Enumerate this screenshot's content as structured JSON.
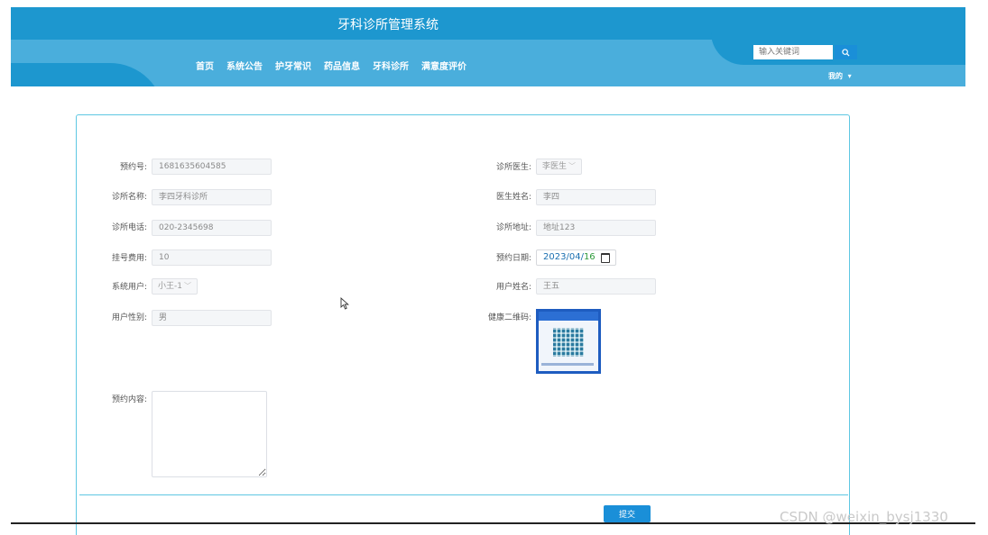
{
  "header": {
    "site_title": "牙科诊所管理系统",
    "nav": [
      "首页",
      "系统公告",
      "护牙常识",
      "药品信息",
      "牙科诊所",
      "满意度评价"
    ],
    "search_placeholder": "输入关键词",
    "user_menu": "我的"
  },
  "form": {
    "booking_no": {
      "label": "预约号:",
      "value": "1681635604585"
    },
    "clinic_name": {
      "label": "诊所名称:",
      "value": "李四牙科诊所"
    },
    "clinic_phone": {
      "label": "诊所电话:",
      "value": "020-2345698"
    },
    "reg_fee": {
      "label": "挂号费用:",
      "value": "10"
    },
    "sys_user": {
      "label": "系统用户:",
      "value": "小王-1"
    },
    "user_gender": {
      "label": "用户性别:",
      "value": "男"
    },
    "booking_content": {
      "label": "预约内容:",
      "value": ""
    },
    "clinic_doctor": {
      "label": "诊所医生:",
      "value": "李医生"
    },
    "doctor_name": {
      "label": "医生姓名:",
      "value": "李四"
    },
    "clinic_address": {
      "label": "诊所地址:",
      "value": "地址123"
    },
    "booking_date": {
      "label": "预约日期:",
      "year": "2023",
      "month": "04",
      "day": "16"
    },
    "user_name": {
      "label": "用户姓名:",
      "value": "王五"
    },
    "health_qr": {
      "label": "健康二维码:"
    },
    "submit_label": "提交"
  },
  "watermark": "CSDN @weixin_bysj1330",
  "colors": {
    "header_dark": "#1d97cf",
    "header_light": "#4aaedc",
    "accent": "#1a8fd8",
    "card_border": "#5ec7e2"
  }
}
